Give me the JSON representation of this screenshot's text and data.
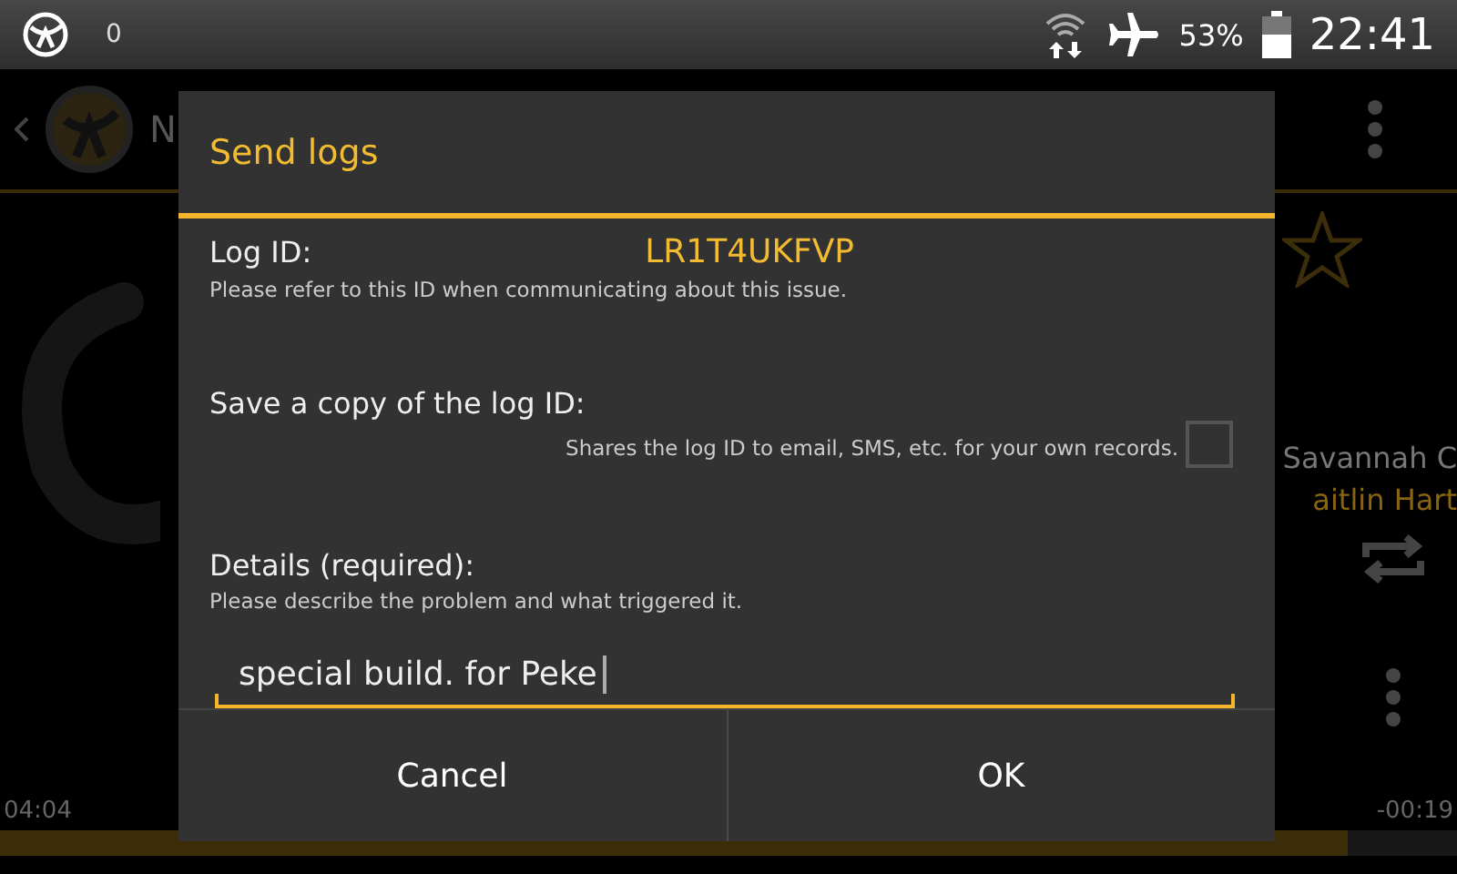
{
  "status_bar": {
    "notification_count": "0",
    "battery_percent": "53%",
    "time": "22:41"
  },
  "background_app": {
    "title": "N",
    "artist": "Savannah C",
    "subtitle": "aitlin Hart",
    "elapsed": "04:04",
    "remaining": "-00:19",
    "progress": {
      "level": 0.925
    }
  },
  "dialog": {
    "title": "Send logs",
    "log_id": {
      "label": "Log ID:",
      "value": "LR1T4UKFVP",
      "hint": "Please refer to this ID when communicating about this issue."
    },
    "save_copy": {
      "label": "Save a copy of the log ID:",
      "hint": "Shares the log ID to email, SMS, etc. for your own records.",
      "checked": false
    },
    "details": {
      "label": "Details (required):",
      "hint": "Please describe the problem and what triggered it.",
      "value": "special build. for Peke"
    },
    "buttons": [
      "Cancel",
      "OK"
    ]
  }
}
